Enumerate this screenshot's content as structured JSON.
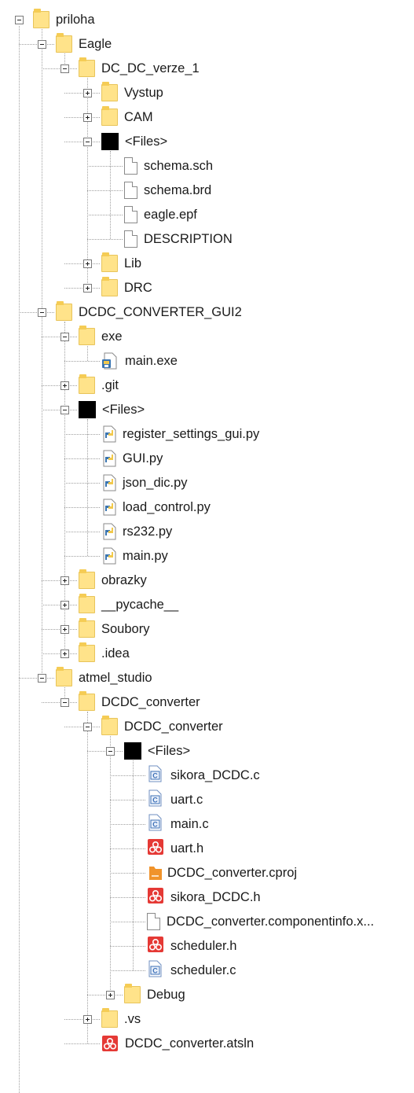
{
  "tree": [
    {
      "label": "priloha",
      "type": "folder",
      "level": 0,
      "toggle": "minus"
    },
    {
      "label": "Eagle",
      "type": "folder",
      "level": 1,
      "toggle": "minus"
    },
    {
      "label": "DC_DC_verze_1",
      "type": "folder",
      "level": 2,
      "toggle": "minus"
    },
    {
      "label": "Vystup",
      "type": "folder",
      "level": 3,
      "toggle": "plus"
    },
    {
      "label": "CAM",
      "type": "folder",
      "level": 3,
      "toggle": "plus"
    },
    {
      "label": "<Files>",
      "type": "files-group",
      "level": 3,
      "toggle": "minus"
    },
    {
      "label": "schema.sch",
      "type": "file",
      "level": 4
    },
    {
      "label": "schema.brd",
      "type": "file",
      "level": 4
    },
    {
      "label": "eagle.epf",
      "type": "file",
      "level": 4
    },
    {
      "label": "DESCRIPTION",
      "type": "file",
      "level": 4
    },
    {
      "label": "Lib",
      "type": "folder",
      "level": 3,
      "toggle": "plus"
    },
    {
      "label": "DRC",
      "type": "folder",
      "level": 3,
      "toggle": "plus"
    },
    {
      "label": "DCDC_CONVERTER_GUI2",
      "type": "folder",
      "level": 1,
      "toggle": "minus"
    },
    {
      "label": "exe",
      "type": "folder",
      "level": 2,
      "toggle": "minus"
    },
    {
      "label": "main.exe",
      "type": "exe",
      "level": 3
    },
    {
      "label": ".git",
      "type": "folder",
      "level": 2,
      "toggle": "plus"
    },
    {
      "label": "<Files>",
      "type": "files-group",
      "level": 2,
      "toggle": "minus"
    },
    {
      "label": "register_settings_gui.py",
      "type": "py",
      "level": 3
    },
    {
      "label": "GUI.py",
      "type": "py",
      "level": 3
    },
    {
      "label": "json_dic.py",
      "type": "py",
      "level": 3
    },
    {
      "label": "load_control.py",
      "type": "py",
      "level": 3
    },
    {
      "label": "rs232.py",
      "type": "py",
      "level": 3
    },
    {
      "label": "main.py",
      "type": "py",
      "level": 3
    },
    {
      "label": "obrazky",
      "type": "folder",
      "level": 2,
      "toggle": "plus"
    },
    {
      "label": "__pycache__",
      "type": "folder",
      "level": 2,
      "toggle": "plus"
    },
    {
      "label": "Soubory",
      "type": "folder",
      "level": 2,
      "toggle": "plus"
    },
    {
      "label": ".idea",
      "type": "folder",
      "level": 2,
      "toggle": "plus"
    },
    {
      "label": "atmel_studio",
      "type": "folder",
      "level": 1,
      "toggle": "minus"
    },
    {
      "label": "DCDC_converter",
      "type": "folder",
      "level": 2,
      "toggle": "minus"
    },
    {
      "label": "DCDC_converter",
      "type": "folder",
      "level": 3,
      "toggle": "minus"
    },
    {
      "label": "<Files>",
      "type": "files-group",
      "level": 4,
      "toggle": "minus"
    },
    {
      "label": "sikora_DCDC.c",
      "type": "c",
      "level": 5
    },
    {
      "label": "uart.c",
      "type": "c",
      "level": 5
    },
    {
      "label": "main.c",
      "type": "c",
      "level": 5
    },
    {
      "label": "uart.h",
      "type": "h",
      "level": 5
    },
    {
      "label": "DCDC_converter.cproj",
      "type": "cproj",
      "level": 5
    },
    {
      "label": "sikora_DCDC.h",
      "type": "h",
      "level": 5
    },
    {
      "label": "DCDC_converter.componentinfo.x...",
      "type": "file",
      "level": 5
    },
    {
      "label": "scheduler.h",
      "type": "h",
      "level": 5
    },
    {
      "label": "scheduler.c",
      "type": "c",
      "level": 5
    },
    {
      "label": "Debug",
      "type": "folder",
      "level": 4,
      "toggle": "plus"
    },
    {
      "label": ".vs",
      "type": "folder",
      "level": 3,
      "toggle": "plus"
    },
    {
      "label": "DCDC_converter.atsln",
      "type": "atsln",
      "level": 3
    }
  ],
  "colors": {
    "folder": "#ffe38a",
    "py_blue": "#3a75b0",
    "py_yellow": "#f2c94c",
    "h_red": "#e53935",
    "c_blue": "#3b6fb6",
    "cproj_orange": "#f0932b"
  }
}
